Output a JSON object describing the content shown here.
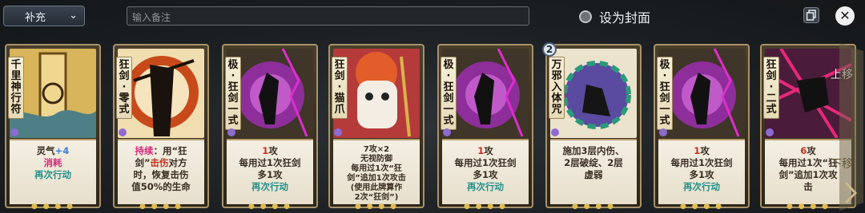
{
  "topbar": {
    "category": "补充",
    "note_placeholder": "输入备注",
    "cover_label": "设为封面"
  },
  "cards": [
    {
      "name": [
        "千",
        "里",
        "神",
        "行",
        "符"
      ],
      "lines": [
        {
          "t": "灵气",
          "c": ""
        },
        {
          "t": "+4",
          "c": "blue"
        },
        {
          "t": "消耗",
          "c": "pink"
        },
        {
          "t": "再次行动",
          "c": "teal"
        }
      ],
      "layout": "ling"
    },
    {
      "name": [
        "狂",
        "剑",
        "·",
        "零",
        "式"
      ],
      "lines": [
        {
          "t": "持续",
          "c": "pink"
        },
        {
          "t": "：用“狂",
          "c": ""
        },
        {
          "t": "剑”",
          "c": ""
        },
        {
          "t": "击伤",
          "c": "red"
        },
        {
          "t": "对方",
          "c": ""
        },
        {
          "t": "时，恢复击伤",
          "c": ""
        },
        {
          "t": "值50%的生命",
          "c": ""
        }
      ],
      "layout": "rich2"
    },
    {
      "name": [
        "极",
        "·",
        "狂",
        "剑",
        "一",
        "式"
      ],
      "lines": [
        {
          "t": "1",
          "c": "red"
        },
        {
          "t": "攻",
          "c": ""
        },
        {
          "t": "每用过1次狂剑",
          "c": ""
        },
        {
          "t": "多1攻",
          "c": ""
        },
        {
          "t": "再次行动",
          "c": "teal"
        }
      ],
      "layout": "atk"
    },
    {
      "name": [
        "狂",
        "剑",
        "·",
        "猫",
        "爪"
      ],
      "lines": [
        {
          "t": "7攻×2",
          "c": ""
        },
        {
          "t": "无视防御",
          "c": ""
        },
        {
          "t": "每用过1次“狂",
          "c": ""
        },
        {
          "t": "剑”追加1次攻击",
          "c": ""
        },
        {
          "t": "(使用此牌算作",
          "c": ""
        },
        {
          "t": "2次“狂剑”)",
          "c": ""
        }
      ],
      "layout": "small"
    },
    {
      "name": [
        "极",
        "·",
        "狂",
        "剑",
        "一",
        "式"
      ],
      "lines": [
        {
          "t": "1",
          "c": "red"
        },
        {
          "t": "攻",
          "c": ""
        },
        {
          "t": "每用过1次狂剑",
          "c": ""
        },
        {
          "t": "多1攻",
          "c": ""
        },
        {
          "t": "再次行动",
          "c": "teal"
        }
      ],
      "layout": "atk"
    },
    {
      "name": [
        "万",
        "邪",
        "入",
        "体",
        "咒"
      ],
      "badge": "2",
      "lines": [
        {
          "t": "施加3层内伤、",
          "c": ""
        },
        {
          "t": "2层破绽、2层",
          "c": ""
        },
        {
          "t": "虚弱",
          "c": ""
        }
      ],
      "layout": "plain"
    },
    {
      "name": [
        "极",
        "·",
        "狂",
        "剑",
        "一",
        "式"
      ],
      "lines": [
        {
          "t": "1",
          "c": "red"
        },
        {
          "t": "攻",
          "c": ""
        },
        {
          "t": "每用过1次狂剑",
          "c": ""
        },
        {
          "t": "多1攻",
          "c": ""
        },
        {
          "t": "再次行动",
          "c": "teal"
        }
      ],
      "layout": "atk"
    },
    {
      "name": [
        "狂",
        "剑",
        "·",
        "二",
        "式"
      ],
      "lines": [
        {
          "t": "6",
          "c": "red"
        },
        {
          "t": "攻",
          "c": ""
        },
        {
          "t": "每用过1次“狂",
          "c": ""
        },
        {
          "t": "剑”追加1次攻",
          "c": ""
        },
        {
          "t": "击",
          "c": ""
        }
      ],
      "layout": "atk2",
      "overlay_up": "上移",
      "overlay_down": "下移"
    }
  ],
  "colors": {
    "accent": "#a9926a",
    "teal": "#23908a",
    "red": "#c33120",
    "pink": "#d42a7a"
  }
}
